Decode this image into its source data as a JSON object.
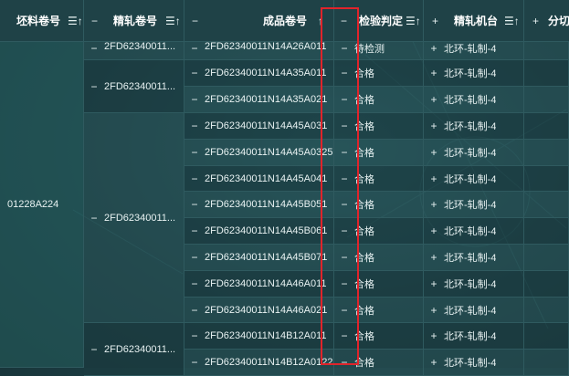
{
  "headers": {
    "billet": {
      "label": "坯料卷号",
      "sort_icon": "sort-icon"
    },
    "finish_roll": {
      "label": "精轧卷号",
      "sort_icon": "sort-icon",
      "toggle": "−"
    },
    "product": {
      "label": "成品卷号",
      "sort_icon": "sort-icon",
      "toggle": "−"
    },
    "inspection": {
      "label": "检验判定",
      "sort_icon": "sort-icon",
      "toggle": "−"
    },
    "finish_mill": {
      "label": "精轧机台",
      "sort_icon": "sort-icon",
      "toggle": "+"
    },
    "split": {
      "label": "分切",
      "toggle": "+"
    }
  },
  "billet_value": "01228A224",
  "finish_groups": [
    {
      "toggle": "−",
      "label": "2FD62340011..."
    },
    {
      "toggle": "−",
      "label": "2FD62340011..."
    },
    {
      "toggle": "−",
      "label": "2FD62340011..."
    },
    {
      "toggle": "−",
      "label": "2FD62340011..."
    }
  ],
  "rows": [
    {
      "toggle": "−",
      "product": "2FD62340011N14A26A011",
      "inspect_toggle": "−",
      "inspection": "待检测",
      "mill_toggle": "+",
      "mill": "北环-轧制-4"
    },
    {
      "toggle": "−",
      "product": "2FD62340011N14A35A011",
      "inspect_toggle": "−",
      "inspection": "合格",
      "mill_toggle": "+",
      "mill": "北环-轧制-4"
    },
    {
      "toggle": "−",
      "product": "2FD62340011N14A35A021",
      "inspect_toggle": "−",
      "inspection": "合格",
      "mill_toggle": "+",
      "mill": "北环-轧制-4"
    },
    {
      "toggle": "−",
      "product": "2FD62340011N14A45A031",
      "inspect_toggle": "−",
      "inspection": "合格",
      "mill_toggle": "+",
      "mill": "北环-轧制-4"
    },
    {
      "toggle": "−",
      "product": "2FD62340011N14A45A0325",
      "inspect_toggle": "−",
      "inspection": "合格",
      "mill_toggle": "+",
      "mill": "北环-轧制-4"
    },
    {
      "toggle": "−",
      "product": "2FD62340011N14A45A041",
      "inspect_toggle": "−",
      "inspection": "合格",
      "mill_toggle": "+",
      "mill": "北环-轧制-4"
    },
    {
      "toggle": "−",
      "product": "2FD62340011N14A45B051",
      "inspect_toggle": "−",
      "inspection": "合格",
      "mill_toggle": "+",
      "mill": "北环-轧制-4"
    },
    {
      "toggle": "−",
      "product": "2FD62340011N14A45B061",
      "inspect_toggle": "−",
      "inspection": "合格",
      "mill_toggle": "+",
      "mill": "北环-轧制-4"
    },
    {
      "toggle": "−",
      "product": "2FD62340011N14A45B071",
      "inspect_toggle": "−",
      "inspection": "合格",
      "mill_toggle": "+",
      "mill": "北环-轧制-4"
    },
    {
      "toggle": "−",
      "product": "2FD62340011N14A46A011",
      "inspect_toggle": "−",
      "inspection": "合格",
      "mill_toggle": "+",
      "mill": "北环-轧制-4"
    },
    {
      "toggle": "−",
      "product": "2FD62340011N14A46A021",
      "inspect_toggle": "−",
      "inspection": "合格",
      "mill_toggle": "+",
      "mill": "北环-轧制-4"
    },
    {
      "toggle": "−",
      "product": "2FD62340011N14B12A011",
      "inspect_toggle": "−",
      "inspection": "合格",
      "mill_toggle": "+",
      "mill": "北环-轧制-4"
    },
    {
      "toggle": "−",
      "product": "2FD62340011N14B12A0122",
      "inspect_toggle": "−",
      "inspection": "合格",
      "mill_toggle": "+",
      "mill": "北环-轧制-4"
    }
  ]
}
